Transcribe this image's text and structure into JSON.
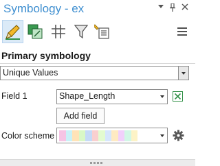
{
  "window": {
    "title": "Symbology - ex",
    "pin_glyph": "⊥",
    "close_glyph": "✕"
  },
  "toolbar": {
    "tools": [
      {
        "name": "primary-symbology-tool",
        "icon": "pencil-icon",
        "active": true
      },
      {
        "name": "vary-symbology-tool",
        "icon": "layers-icon",
        "active": false
      },
      {
        "name": "symbol-layer-drawing-tool",
        "icon": "grid-hash-icon",
        "active": false
      },
      {
        "name": "advanced-symbology-tool",
        "icon": "funnel-icon",
        "active": false
      },
      {
        "name": "labels-tool",
        "icon": "label-list-icon",
        "active": false
      }
    ],
    "menu_icon": "hamburger-menu-icon"
  },
  "panel": {
    "section_title": "Primary symbology",
    "renderer_value": "Unique Values",
    "field1_label": "Field 1",
    "field1_value": "Shape_Length",
    "add_field_label": "Add field",
    "color_scheme_label": "Color scheme",
    "color_scheme_colors": [
      "#f6c4e4",
      "#c9f1f7",
      "#ffe3b7",
      "#d9f8c6",
      "#c5daf7",
      "#f9cfcf",
      "#e3fbd0",
      "#d6e6fd",
      "#ffeac2",
      "#f1d0fb",
      "#d1f7e6",
      "#fdf3c6"
    ]
  },
  "colors": {
    "title_blue": "#3f8fd0",
    "active_tool_bg": "#dbeaf7",
    "expression_icon_green": "#2f8f45",
    "pencil_yellow": "#f2b82b"
  }
}
